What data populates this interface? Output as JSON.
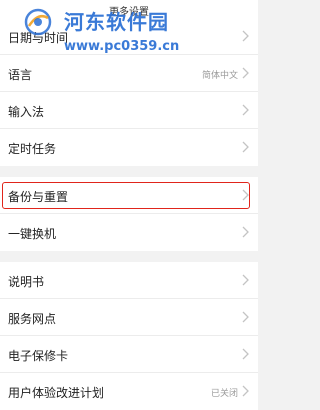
{
  "header": {
    "title": "更多设置"
  },
  "groups": [
    {
      "items": [
        {
          "label": "日期与时间",
          "value": ""
        },
        {
          "label": "语言",
          "value": "简体中文"
        },
        {
          "label": "输入法",
          "value": ""
        },
        {
          "label": "定时任务",
          "value": ""
        }
      ]
    },
    {
      "items": [
        {
          "label": "备份与重置",
          "value": ""
        },
        {
          "label": "一键换机",
          "value": ""
        }
      ]
    },
    {
      "items": [
        {
          "label": "说明书",
          "value": ""
        },
        {
          "label": "服务网点",
          "value": ""
        },
        {
          "label": "电子保修卡",
          "value": ""
        },
        {
          "label": "用户体验改进计划",
          "value": "已关闭"
        }
      ]
    }
  ],
  "watermark": {
    "title": "河东软件园",
    "url": "www.pc0359.cn"
  },
  "colors": {
    "highlight": "#e0251b",
    "watermark": "#2a6fd4"
  },
  "icons": {
    "row_arrow": "chevron-right-icon",
    "logo": "watermark-logo-icon"
  }
}
